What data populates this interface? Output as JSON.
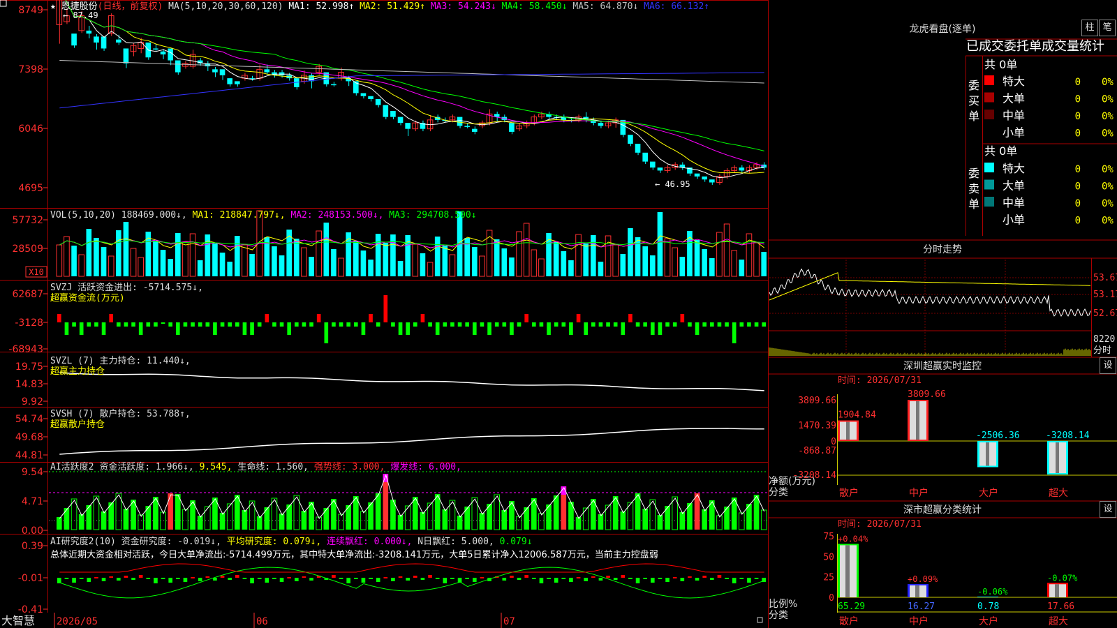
{
  "app": {
    "brand": "大智慧"
  },
  "kline": {
    "stock_name": "恩捷股份",
    "period_label": "(日线，前复权)",
    "ma_label": "MA(5,10,20,30,60,120)",
    "ma_items": [
      {
        "name": "MA1:",
        "value": "52.998↑",
        "color": "#ffffff"
      },
      {
        "name": "MA2:",
        "value": "51.429↑",
        "color": "#ffff00"
      },
      {
        "name": "MA3:",
        "value": "54.243↓",
        "color": "#ff00ff"
      },
      {
        "name": "MA4:",
        "value": "58.450↓",
        "color": "#00ff00"
      },
      {
        "name": "MA5:",
        "value": "64.870↓",
        "color": "#c0c0c0"
      },
      {
        "name": "MA6:",
        "value": "66.132↑",
        "color": "#3333ff"
      }
    ],
    "y_ticks": [
      "8749",
      "7398",
      "6046",
      "4695"
    ],
    "high_label": "87.49",
    "low_label": "46.95",
    "x_ticks": [
      "2026/05",
      "06",
      "07"
    ],
    "bars": [
      [
        59,
        12,
        2,
        -8
      ],
      [
        60,
        2,
        3,
        -1
      ],
      [
        56,
        -4,
        -1,
        -1
      ],
      [
        57,
        5,
        2,
        -1
      ],
      [
        57,
        -1,
        2,
        -2
      ],
      [
        55,
        -2,
        1,
        -3
      ],
      [
        55,
        -4,
        -1,
        -1
      ],
      [
        56,
        6,
        1,
        -1
      ],
      [
        54,
        -1,
        2,
        -1
      ],
      [
        51,
        -5,
        -1,
        -2
      ],
      [
        50,
        2,
        1,
        -2
      ],
      [
        51,
        2,
        2,
        -2
      ],
      [
        53,
        -5,
        -1,
        -1
      ],
      [
        51,
        0,
        2,
        -1
      ],
      [
        50,
        -1,
        1,
        -2
      ],
      [
        51,
        -4,
        -1,
        -2
      ],
      [
        47,
        -4,
        -1,
        -1
      ],
      [
        45,
        1,
        1,
        -1
      ],
      [
        45,
        4,
        2,
        -1
      ],
      [
        47,
        -1,
        1,
        -1
      ],
      [
        46,
        -1,
        1,
        -2
      ],
      [
        44,
        -1,
        1,
        -2
      ],
      [
        44,
        -2,
        -1,
        -2
      ],
      [
        41,
        -2,
        -1,
        -1
      ],
      [
        40,
        -1,
        -1,
        -1
      ],
      [
        41,
        1,
        1,
        -1
      ],
      [
        41,
        0,
        1,
        -1
      ],
      [
        41,
        3,
        2,
        -1
      ],
      [
        44,
        -1,
        2,
        -1
      ],
      [
        43,
        -1,
        1,
        -1
      ],
      [
        43,
        -1,
        1,
        -1
      ],
      [
        42,
        -1,
        1,
        -1
      ],
      [
        41,
        -3,
        -1,
        -1
      ],
      [
        40,
        2,
        2,
        -1
      ],
      [
        42,
        -2,
        1,
        -3
      ],
      [
        43,
        2,
        1,
        -1
      ],
      [
        43,
        -4,
        -1,
        -1
      ],
      [
        39,
        0,
        1,
        -1
      ],
      [
        41,
        2,
        2,
        -1
      ],
      [
        41,
        -1,
        1,
        -2
      ],
      [
        40,
        -4,
        -1,
        -1
      ],
      [
        36,
        -1,
        -1,
        -1
      ],
      [
        35,
        -1,
        -1,
        -1
      ],
      [
        34,
        -2,
        -1,
        -1
      ],
      [
        32,
        -4,
        -1,
        -1
      ],
      [
        30,
        -2,
        -1,
        -1
      ],
      [
        28,
        -2,
        -1,
        -1
      ],
      [
        26,
        -2,
        -1,
        -3
      ],
      [
        24,
        2,
        1,
        -1
      ],
      [
        26,
        -2,
        1,
        -1
      ],
      [
        24,
        3,
        2,
        -1
      ],
      [
        28,
        -1,
        1,
        -1
      ],
      [
        27,
        0,
        1,
        -1
      ],
      [
        27,
        1,
        1,
        -1
      ],
      [
        28,
        -3,
        -1,
        -1
      ],
      [
        25,
        0,
        1,
        -1
      ],
      [
        24,
        -1,
        1,
        -1
      ],
      [
        25,
        1,
        1,
        -1
      ],
      [
        26,
        3,
        2,
        -1
      ],
      [
        29,
        -1,
        1,
        -2
      ],
      [
        28,
        -1,
        1,
        -1
      ],
      [
        26,
        -3,
        -1,
        -1
      ],
      [
        24,
        1,
        1,
        -1
      ],
      [
        25,
        1,
        1,
        -1
      ],
      [
        26,
        2,
        1,
        -1
      ],
      [
        28,
        1,
        1,
        -1
      ],
      [
        29,
        -1,
        1,
        -1
      ],
      [
        28,
        0,
        1,
        -1
      ],
      [
        28,
        -1,
        1,
        -1
      ],
      [
        27,
        0,
        1,
        -1
      ],
      [
        27,
        1,
        1,
        -1
      ],
      [
        28,
        -1,
        2,
        -1
      ],
      [
        27,
        -1,
        1,
        -1
      ],
      [
        26,
        -1,
        1,
        -1
      ],
      [
        25,
        1,
        1,
        -1
      ],
      [
        26,
        1,
        1,
        -2
      ],
      [
        27,
        -5,
        -1,
        -1
      ],
      [
        22,
        -3,
        -1,
        -1
      ],
      [
        19,
        -3,
        -1,
        -1
      ],
      [
        16,
        -3,
        -1,
        -1
      ],
      [
        13,
        -2,
        -1,
        -1
      ],
      [
        11,
        -1,
        -1,
        -1
      ],
      [
        10,
        1,
        1,
        -1
      ],
      [
        11,
        1,
        1,
        -1
      ],
      [
        12,
        -1,
        1,
        -1
      ],
      [
        11,
        -2,
        -1,
        -1
      ],
      [
        9,
        -1,
        -1,
        -1
      ],
      [
        8,
        -1,
        -1,
        -1
      ],
      [
        7,
        -1,
        -1,
        -1
      ],
      [
        6,
        2,
        1,
        -1
      ],
      [
        8,
        2,
        1,
        -1
      ],
      [
        10,
        1,
        1,
        -1
      ],
      [
        11,
        -1,
        1,
        -1
      ],
      [
        10,
        1,
        1,
        -1
      ],
      [
        11,
        1,
        1,
        -1
      ],
      [
        12,
        -1,
        1,
        -1
      ]
    ]
  },
  "vol": {
    "label": "VOL(5,10,20)",
    "value": "188469.000↓,",
    "ma_items": [
      {
        "name": "MA1:",
        "value": "218847.797↓,",
        "color": "#ffff00"
      },
      {
        "name": "MA2:",
        "value": "248153.500↓,",
        "color": "#ff00ff"
      },
      {
        "name": "MA3:",
        "value": "294708.500↓",
        "color": "#00ff00"
      }
    ],
    "y_ticks": [
      "57732",
      "28509"
    ],
    "unit": "X10"
  },
  "svzj": {
    "label": "SVZJ",
    "title": "活跃资金进出:",
    "value": "-5714.575↓,",
    "subtitle": "超赢资金流(万元)",
    "y_ticks": [
      "62687",
      "-3128",
      "-68943"
    ]
  },
  "svzl": {
    "label": "SVZL (7)",
    "title": "主力持仓:",
    "value": "11.440↓,",
    "subtitle": "超赢主力持仓",
    "y_ticks": [
      "19.75",
      "14.83",
      "9.92"
    ]
  },
  "svsh": {
    "label": "SVSH (7)",
    "title": "散户持仓:",
    "value": "53.788↑,",
    "subtitle": "超赢散户持仓",
    "y_ticks": [
      "54.74",
      "49.68",
      "44.81"
    ]
  },
  "ai_active": {
    "label": "AI活跃度2",
    "title": "资金活跃度:",
    "value1": "1.966↓,",
    "value2": "9.545,",
    "life_label": "生命线:",
    "life_value": "1.560,",
    "strong_label": "强势线:",
    "strong_value": "3.000,",
    "burst_label": "爆发线:",
    "burst_value": "6.000,",
    "y_ticks": [
      "9.54",
      "4.71",
      "0.00"
    ]
  },
  "ai_research": {
    "label": "AI研究度2(10)",
    "title": "资金研究度:",
    "value": "-0.019↓,",
    "avg_label": "平均研究度:",
    "avg_value": "0.079↓,",
    "red_label": "连续飘红:",
    "red_value": "0.000↓,",
    "n_label": "N日飘红:",
    "n_value": "5.000,",
    "last_value": "0.079↓",
    "summary": "总体近期大资金相对活跃，今日大单净流出:-5714.499万元，其中特大单净流出:-3208.141万元，大单5日累计净入12006.587万元，当前主力控盘弱",
    "y_ticks": [
      "0.39",
      "-0.01",
      "-0.41"
    ]
  },
  "right": {
    "lhb_title": "龙虎看盘(逐单)",
    "btn_bar": "柱",
    "btn_bi": "笔",
    "orders_title": "已成交委托单成交量统计",
    "buy_total": "共 0单",
    "buy_label": "委买单",
    "sell_total": "共 0单",
    "sell_label": "委卖单",
    "buy_rows": [
      {
        "label": "特大",
        "count": "0",
        "pct": "0%",
        "color": "#ff0000"
      },
      {
        "label": "大单",
        "count": "0",
        "pct": "0%",
        "color": "#aa0000"
      },
      {
        "label": "中单",
        "count": "0",
        "pct": "0%",
        "color": "#660000"
      },
      {
        "label": "小单",
        "count": "0",
        "pct": "0%",
        "color": ""
      }
    ],
    "sell_rows": [
      {
        "label": "特大",
        "count": "0",
        "pct": "0%",
        "color": "#00ffff"
      },
      {
        "label": "大单",
        "count": "0",
        "pct": "0%",
        "color": "#009999"
      },
      {
        "label": "中单",
        "count": "0",
        "pct": "0%",
        "color": "#007777"
      },
      {
        "label": "小单",
        "count": "0",
        "pct": "0%",
        "color": ""
      }
    ],
    "intraday_title": "分时走势",
    "intraday_prices": [
      "53.67",
      "53.17",
      "52.67"
    ],
    "intraday_vol": "8220",
    "intraday_unit": "分时",
    "sz_title": "深圳超赢实时监控",
    "sz_time": "时间: 2026/07/31",
    "sz_set": "设",
    "sz_y_ticks": [
      "3809.66",
      "1470.39",
      "0",
      "-868.87",
      "-3208.14"
    ],
    "sz_net_label": "净额(万元)",
    "sz_cat_label": "分类",
    "sz_bars": [
      {
        "cat": "散户",
        "value": 1904.84,
        "label": "1904.84",
        "type": "red"
      },
      {
        "cat": "中户",
        "value": 3809.66,
        "label": "3809.66",
        "type": "red"
      },
      {
        "cat": "大户",
        "value": -2506.36,
        "label": "-2506.36",
        "type": "cyan"
      },
      {
        "cat": "超大",
        "value": -3208.14,
        "label": "-3208.14",
        "type": "cyan"
      }
    ],
    "cls_title": "深市超赢分类统计",
    "cls_time": "时间: 2026/07/31",
    "cls_set": "设",
    "cls_y_ticks": [
      "75",
      "50",
      "25",
      "0"
    ],
    "cls_ratio_label": "比例%",
    "cls_cat_label": "分类",
    "cls_bars": [
      {
        "cat": "散户",
        "value": 65.29,
        "label": "65.29",
        "change": "+0.04%",
        "frame": "#00ff00"
      },
      {
        "cat": "中户",
        "value": 16.27,
        "label": "16.27",
        "change": "+0.09%",
        "frame": "#2222ff"
      },
      {
        "cat": "大户",
        "value": 0.78,
        "label": "0.78",
        "change": "-0.06%",
        "frame": "#00ffff"
      },
      {
        "cat": "超大",
        "value": 17.66,
        "label": "17.66",
        "change": "-0.07%",
        "frame": "#ff0000"
      }
    ]
  }
}
